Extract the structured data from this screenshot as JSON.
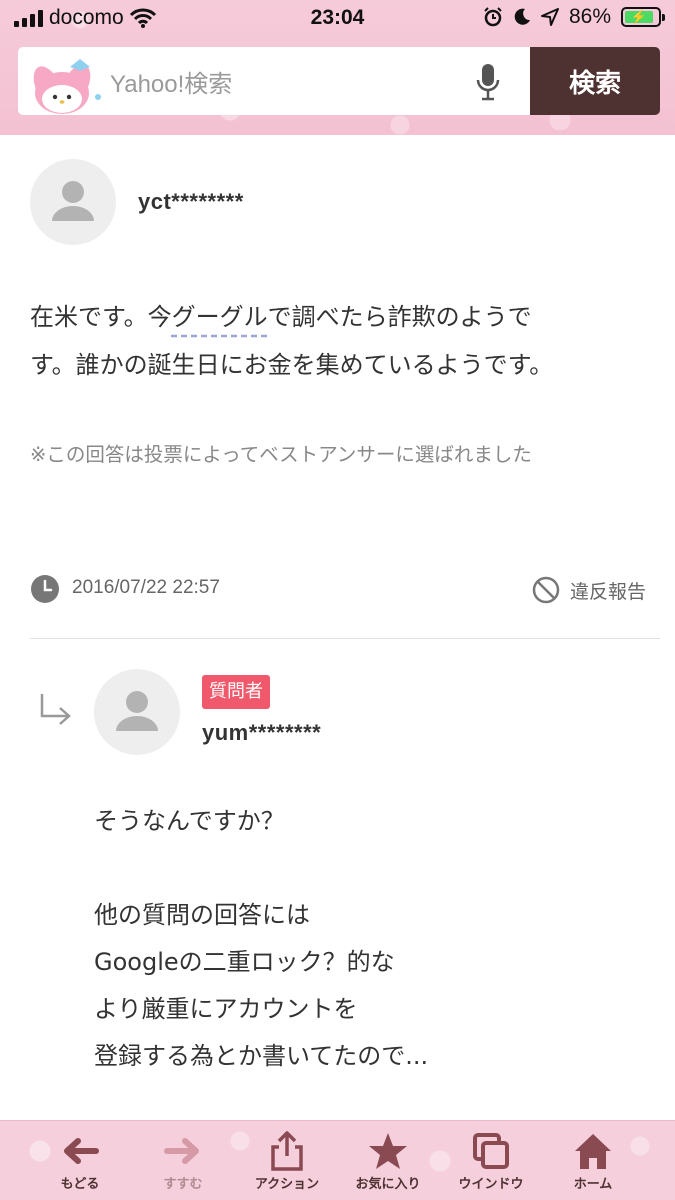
{
  "status_bar": {
    "carrier": "docomo",
    "time": "23:04",
    "battery": "86%",
    "battery_level": 0.86
  },
  "search": {
    "placeholder": "Yahoo!検索",
    "button_label": "検索"
  },
  "answer": {
    "username": "yct********",
    "body_line1_before": "在米です。今",
    "body_link": "グーグル",
    "body_line1_after": "で調べたら詐欺のようで",
    "body_line2": "す。誰かの誕生日にお金を集めているようです。",
    "best_answer_note": "※この回答は投票によってベストアンサーに選ばれました",
    "date": "2016/07/22 22:57",
    "report_label": "違反報告"
  },
  "reply": {
    "badge": "質問者",
    "username": "yum********",
    "lines": [
      "そうなんですか？",
      "",
      "他の質問の回答には",
      "Googleの二重ロック？的な",
      "より厳重にアカウントを",
      "登録する為とか書いてたので..."
    ]
  },
  "toolbar": {
    "back": "もどる",
    "forward": "すすむ",
    "action": "アクション",
    "favorites": "お気に入り",
    "window": "ウインドウ",
    "home": "ホーム"
  },
  "colors": {
    "header_pink": "#f3c1d2",
    "search_button": "#4e3232",
    "badge": "#f0586b",
    "toolbar_icon": "#8a4a52"
  }
}
